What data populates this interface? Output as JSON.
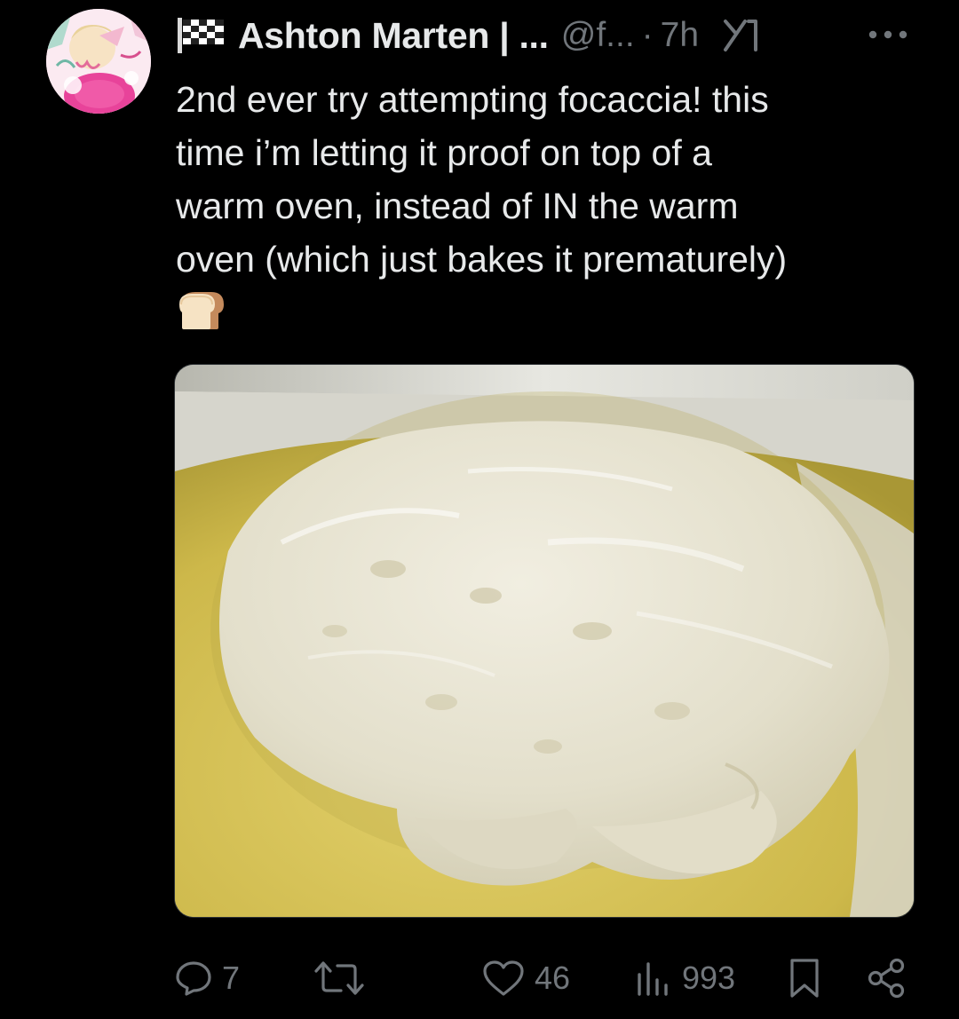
{
  "tweet": {
    "author_display_name": "Ashton Marten | ...",
    "author_handle": "@f...",
    "separator": "·",
    "timestamp": "7h",
    "text_lines": [
      "2nd ever try attempting focaccia! this",
      "time i’m letting it proof on top of a",
      "warm oven, instead of IN the warm",
      "oven (which just bakes it prematurely)"
    ],
    "emoji": "bread-icon",
    "media": "photo-of-proofing-focaccia-dough"
  },
  "actions": {
    "reply_count": "7",
    "retweet_count": "",
    "like_count": "46",
    "views_count": "993"
  },
  "colors": {
    "background": "#000000",
    "text_primary": "#e7e9ea",
    "text_secondary": "#71767b",
    "media_border": "#2f3336"
  },
  "icons": {
    "header": [
      "flag-icon",
      "grok-icon",
      "more-icon"
    ],
    "action_bar": [
      "reply-icon",
      "retweet-icon",
      "like-icon",
      "views-icon",
      "bookmark-icon",
      "share-icon"
    ]
  }
}
